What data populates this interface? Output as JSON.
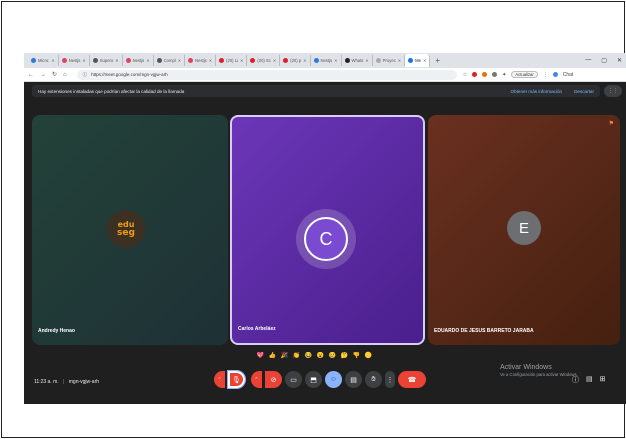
{
  "browser": {
    "tabs": [
      {
        "label": "Micro:",
        "color": "#2b7bd8"
      },
      {
        "label": "Nestjs",
        "color": "#e0445f"
      },
      {
        "label": "Supero",
        "color": "#555555"
      },
      {
        "label": "Nestjs",
        "color": "#e0445f"
      },
      {
        "label": "Compl",
        "color": "#555555"
      },
      {
        "label": "Nestjs",
        "color": "#e0445f"
      },
      {
        "label": "(20) Li",
        "color": "#e02020"
      },
      {
        "label": "(20) Sc",
        "color": "#e02020"
      },
      {
        "label": "(20) p",
        "color": "#e02020"
      },
      {
        "label": "Nestjs",
        "color": "#2b7bd8"
      },
      {
        "label": "Whats",
        "color": "#222222"
      },
      {
        "label": "Proyec",
        "color": "#aaaaaa"
      },
      {
        "label": "Me",
        "color": "#1a73e8",
        "active": true
      }
    ],
    "new_tab": "+",
    "url": "https://meet.google.com/mgn-vgjw-arh",
    "update_label": "Actualizar",
    "chat_label": "Chat"
  },
  "banner": {
    "message": "Hay extensiones instaladas que podrían afectar la calidad de la llamada",
    "link": "Obtener más información",
    "dismiss": "Descartar"
  },
  "participants": [
    {
      "name": "Andredy Henao",
      "logo_line1": "edu",
      "logo_line2": "seg"
    },
    {
      "name": "Carlos Arbeláez",
      "initial": "C",
      "speaking": true
    },
    {
      "name": "EDUARDO DE JESUS BARRETO JARABA",
      "initial": "E"
    }
  ],
  "reactions": [
    "💖",
    "👍",
    "🎉",
    "👏",
    "😂",
    "😮",
    "😢",
    "🤔",
    "👎",
    "🟡"
  ],
  "bottom": {
    "time": "11:23 a. m.",
    "separator": "|",
    "meeting_code": "mgn-vgjw-arh"
  },
  "watermark": {
    "title": "Activar Windows",
    "subtitle": "Ve a Configuración para activar Windows."
  },
  "colors": {
    "meet_bg": "#1f1f1f",
    "danger": "#ea4335",
    "accent": "#8ab4f8",
    "speaking_tile": "#6b36b8"
  }
}
